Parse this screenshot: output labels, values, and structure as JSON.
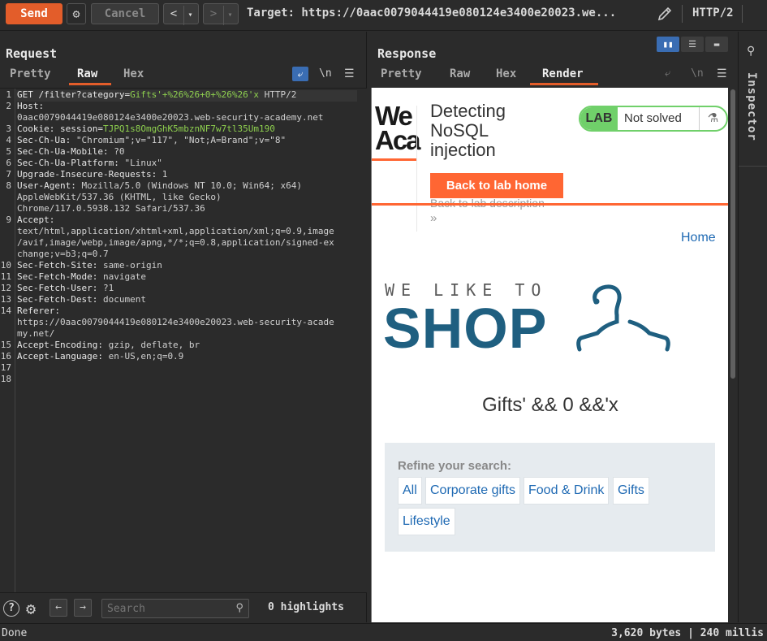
{
  "toolbar": {
    "send_label": "Send",
    "cancel_label": "Cancel",
    "back_label": "<",
    "forward_label": ">",
    "target": "Target: https://0aac0079044419e080124e3400e20023.we...",
    "http_version": "HTTP/2"
  },
  "request": {
    "title": "Request",
    "tabs": [
      "Pretty",
      "Raw",
      "Hex"
    ],
    "active_tab": "Raw",
    "newline_label": "\\n",
    "lines": [
      {
        "n": "1",
        "key": "GET /filter?category=",
        "value": "Gifts'+%26%26+0+%26%26'x",
        "rest": " HTTP/2"
      },
      {
        "n": "2",
        "key": "Host:",
        "value": "",
        "rest": ""
      },
      {
        "n": "",
        "key": "",
        "value": "0aac0079044419e080124e3400e20023.web-security-academy.net",
        "rest": ""
      },
      {
        "n": "3",
        "key": "Cookie: session=",
        "value": "TJPQ1s8OmgGhK5mbznNF7w7tl35Um190",
        "rest": ""
      },
      {
        "n": "4",
        "key": "Sec-Ch-Ua:",
        "value": " \"Chromium\";v=\"117\", \"Not;A=Brand\";v=\"8\"",
        "rest": ""
      },
      {
        "n": "5",
        "key": "Sec-Ch-Ua-Mobile:",
        "value": " ?0",
        "rest": ""
      },
      {
        "n": "6",
        "key": "Sec-Ch-Ua-Platform:",
        "value": " \"Linux\"",
        "rest": ""
      },
      {
        "n": "7",
        "key": "Upgrade-Insecure-Requests:",
        "value": " 1",
        "rest": ""
      },
      {
        "n": "8",
        "key": "User-Agent:",
        "value": " Mozilla/5.0 (Windows NT 10.0; Win64; x64)",
        "rest": ""
      },
      {
        "n": "",
        "key": "",
        "value": "AppleWebKit/537.36 (KHTML, like Gecko)",
        "rest": ""
      },
      {
        "n": "",
        "key": "",
        "value": "Chrome/117.0.5938.132 Safari/537.36",
        "rest": ""
      },
      {
        "n": "9",
        "key": "Accept:",
        "value": "",
        "rest": ""
      },
      {
        "n": "",
        "key": "",
        "value": "text/html,application/xhtml+xml,application/xml;q=0.9,image",
        "rest": ""
      },
      {
        "n": "",
        "key": "",
        "value": "/avif,image/webp,image/apng,*/*;q=0.8,application/signed-ex",
        "rest": ""
      },
      {
        "n": "",
        "key": "",
        "value": "change;v=b3;q=0.7",
        "rest": ""
      },
      {
        "n": "10",
        "key": "Sec-Fetch-Site:",
        "value": " same-origin",
        "rest": ""
      },
      {
        "n": "11",
        "key": "Sec-Fetch-Mode:",
        "value": " navigate",
        "rest": ""
      },
      {
        "n": "12",
        "key": "Sec-Fetch-User:",
        "value": " ?1",
        "rest": ""
      },
      {
        "n": "13",
        "key": "Sec-Fetch-Dest:",
        "value": " document",
        "rest": ""
      },
      {
        "n": "14",
        "key": "Referer:",
        "value": "",
        "rest": ""
      },
      {
        "n": "",
        "key": "",
        "value": "https://0aac0079044419e080124e3400e20023.web-security-acade",
        "rest": ""
      },
      {
        "n": "",
        "key": "",
        "value": "my.net/",
        "rest": ""
      },
      {
        "n": "15",
        "key": "Accept-Encoding:",
        "value": " gzip, deflate, br",
        "rest": ""
      },
      {
        "n": "16",
        "key": "Accept-Language:",
        "value": " en-US,en;q=0.9",
        "rest": ""
      },
      {
        "n": "17",
        "key": "",
        "value": "",
        "rest": ""
      },
      {
        "n": "18",
        "key": "",
        "value": "",
        "rest": ""
      }
    ],
    "search_placeholder": "Search",
    "highlights": "0 highlights"
  },
  "response": {
    "title": "Response",
    "tabs": [
      "Pretty",
      "Raw",
      "Hex",
      "Render"
    ],
    "active_tab": "Render",
    "newline_label": "\\n",
    "render": {
      "logo_text": "We\nAca",
      "lab_title": "Detecting NoSQL injection",
      "lab_badge": "LAB",
      "lab_status": "Not solved",
      "back_home": "Back to lab home",
      "back_description": "Back to lab description",
      "home_link": "Home",
      "tagline": "WE LIKE TO",
      "shop": "SHOP",
      "heading": "Gifts' && 0 &&'x",
      "refine_label": "Refine your search:",
      "categories": [
        "All",
        "Corporate gifts",
        "Food & Drink",
        "Gifts",
        "Lifestyle"
      ]
    }
  },
  "inspector": {
    "label": "Inspector"
  },
  "status": {
    "left": "Done",
    "right": "3,620 bytes | 240 millis"
  },
  "colors": {
    "send": "#e35d2a",
    "accent_blue": "#3a6db3",
    "lab_green": "#70d06a",
    "orange": "#ff6633",
    "shop_blue": "#1f5f80"
  }
}
